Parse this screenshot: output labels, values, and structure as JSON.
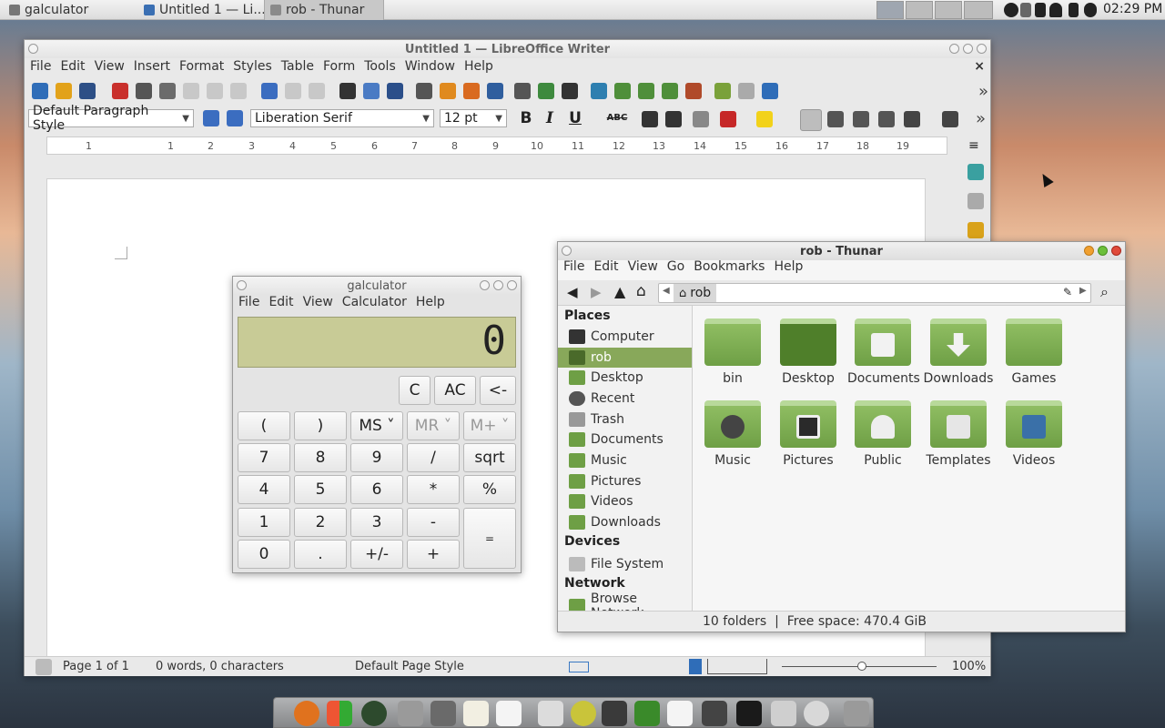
{
  "top_panel": {
    "tasks": [
      {
        "label": "galculator",
        "active": false
      },
      {
        "label": "Untitled 1 — Li...",
        "active": false
      },
      {
        "label": "rob - Thunar",
        "active": true
      }
    ],
    "clock": "02:29 PM"
  },
  "writer": {
    "title": "Untitled 1 — LibreOffice Writer",
    "menu": [
      "File",
      "Edit",
      "View",
      "Insert",
      "Format",
      "Styles",
      "Table",
      "Form",
      "Tools",
      "Window",
      "Help"
    ],
    "paragraph_style": "Default Paragraph Style",
    "font_name": "Liberation Serif",
    "font_size": "12 pt",
    "format_buttons": {
      "bold": "B",
      "italic": "I",
      "underline": "U",
      "strike": "ABC"
    },
    "ruler_numbers": [
      "1",
      "1",
      "2",
      "3",
      "4",
      "5",
      "6",
      "7",
      "8",
      "9",
      "10",
      "11",
      "12",
      "13",
      "14",
      "15",
      "16",
      "17",
      "18",
      "19"
    ],
    "status": {
      "page": "Page 1 of 1",
      "words": "0 words, 0 characters",
      "page_style": "Default Page Style",
      "zoom": "100%"
    }
  },
  "galculator": {
    "title": "galculator",
    "menu": [
      "File",
      "Edit",
      "View",
      "Calculator",
      "Help"
    ],
    "display": "0",
    "top_buttons": [
      "C",
      "AC",
      "<-"
    ],
    "rows": [
      [
        "(",
        ")",
        "MS ˅",
        "MR ˅",
        "M+ ˅"
      ],
      [
        "7",
        "8",
        "9",
        "/",
        "sqrt"
      ],
      [
        "4",
        "5",
        "6",
        "*",
        "%"
      ],
      [
        "1",
        "2",
        "3",
        "-",
        "="
      ],
      [
        "0",
        ".",
        "+/-",
        "+"
      ]
    ]
  },
  "thunar": {
    "title": "rob - Thunar",
    "menu": [
      "File",
      "Edit",
      "View",
      "Go",
      "Bookmarks",
      "Help"
    ],
    "path": "rob",
    "places_header": "Places",
    "places": [
      "Computer",
      "rob",
      "Desktop",
      "Recent",
      "Trash",
      "Documents",
      "Music",
      "Pictures",
      "Videos",
      "Downloads"
    ],
    "devices_header": "Devices",
    "devices": [
      "File System"
    ],
    "network_header": "Network",
    "network": [
      "Browse Network"
    ],
    "folders": [
      "bin",
      "Desktop",
      "Documents",
      "Downloads",
      "Games",
      "Music",
      "Pictures",
      "Public",
      "Templates",
      "Videos"
    ],
    "status": "10 folders  |  Free space: 470.4 GiB"
  },
  "colors": {
    "accent_green": "#88a85a",
    "lcd": "#c8cb96"
  }
}
